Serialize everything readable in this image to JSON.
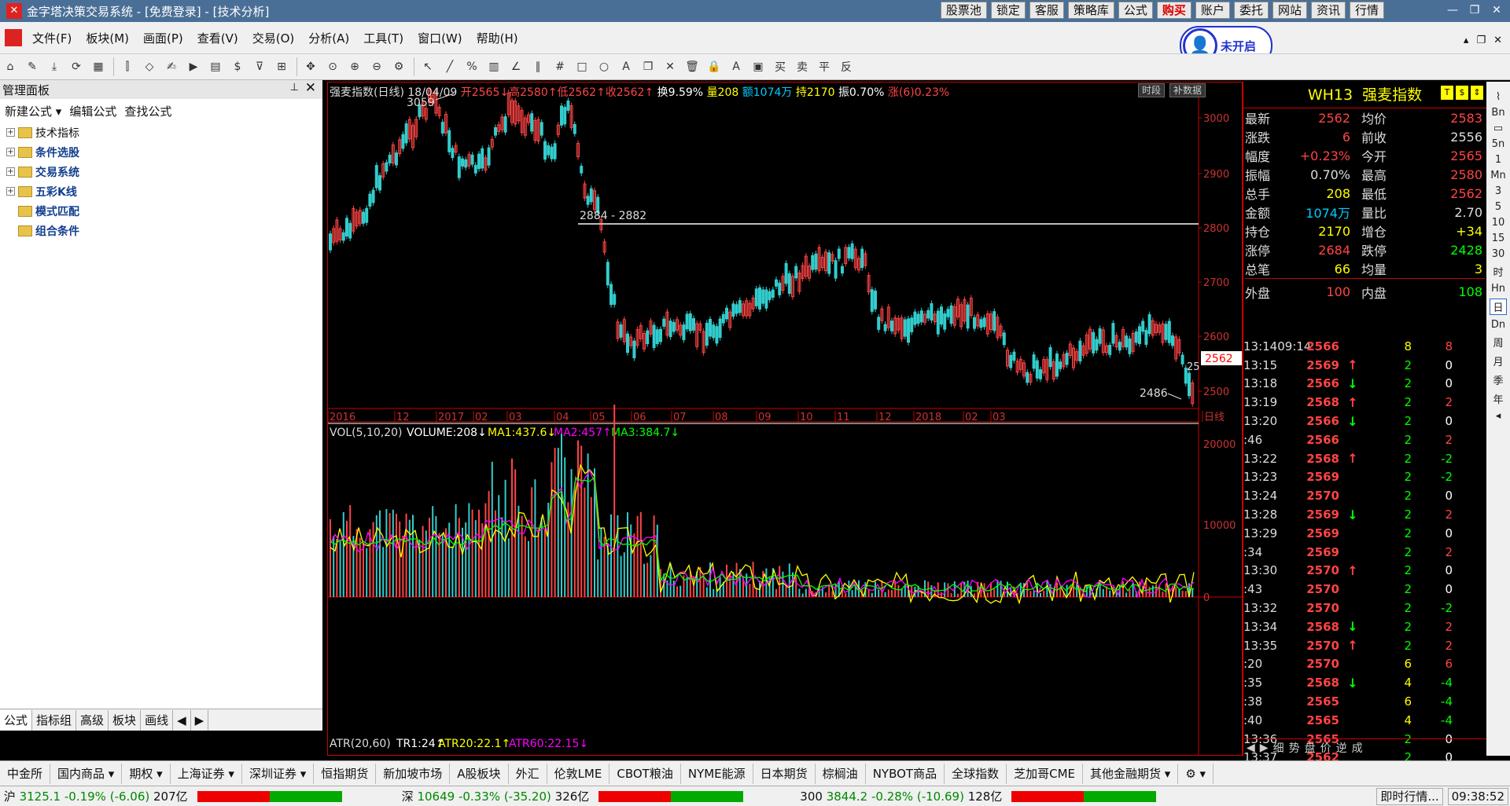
{
  "window": {
    "title": "金字塔决策交易系统 - [免费登录] - [技术分析]",
    "logo_glyph": "✕"
  },
  "top_buttons": [
    "股票池",
    "锁定",
    "客服",
    "策略库",
    "公式",
    "购买",
    "账户",
    "委托",
    "网站",
    "资讯",
    "行情"
  ],
  "window_controls": {
    "minimize": "—",
    "restore": "❐",
    "close": "✕"
  },
  "menu": [
    "文件(F)",
    "板块(M)",
    "画面(P)",
    "查看(V)",
    "交易(O)",
    "分析(A)",
    "工具(T)",
    "窗口(W)",
    "帮助(H)"
  ],
  "login_badge": {
    "icon": "person-icon",
    "text": "未开启"
  },
  "mdi_controls": [
    "▴",
    "❐",
    "✕"
  ],
  "toolbar_icons": [
    "home-icon",
    "pencil-icon",
    "download-icon",
    "refresh-icon",
    "grid-icon",
    "candles-icon",
    "diamond-icon",
    "edit-icon",
    "play-icon",
    "doc-icon",
    "dollar-icon",
    "filter-icon",
    "chart-icon",
    "move-icon",
    "zoom-reset-icon",
    "zoom-in-icon",
    "zoom-out-icon",
    "settings-icon",
    "cursor-icon",
    "line-icon",
    "percent-icon",
    "ruler-icon",
    "angle-icon",
    "parallel-icon",
    "hash-icon",
    "rect-icon",
    "circle-icon",
    "text-icon",
    "copy-icon",
    "delete-icon",
    "trash-icon",
    "lock-icon",
    "color-icon",
    "save-icon",
    "buy-icon",
    "sell-icon",
    "flat-icon",
    "reverse-icon"
  ],
  "toolbar_glyphs": [
    "⌂",
    "✎",
    "⤓",
    "⟳",
    "▦",
    "⫿",
    "◇",
    "✍",
    "▶",
    "▤",
    "$",
    "⊽",
    "⊞",
    "✥",
    "⊙",
    "⊕",
    "⊖",
    "⚙",
    "↖",
    "╱",
    "%",
    "▥",
    "∠",
    "∥",
    "#",
    "□",
    "○",
    "A",
    "❐",
    "✕",
    "🗑",
    "🔒",
    "A",
    "▣",
    "买",
    "卖",
    "平",
    "反"
  ],
  "left_panel": {
    "title": "管理面板",
    "pin": "⊥",
    "close": "✕",
    "links": [
      "新建公式 ▾",
      "编辑公式",
      "查找公式"
    ],
    "tree": [
      "技术指标",
      "条件选股",
      "交易系统",
      "五彩K线",
      "模式匹配",
      "组合条件"
    ],
    "tabs": [
      "公式",
      "指标组",
      "高级",
      "板块",
      "画线",
      "◀",
      "▶"
    ]
  },
  "chart_header": {
    "name": "强麦指数(日线)",
    "date": "18/04/09",
    "open": "开2565↓",
    "high": "高2580↑",
    "low": "低2562↑",
    "close": "收2562↑",
    "turnover": "换9.59%",
    "volume": "量208",
    "amount": "额1074万",
    "oi": "持2170",
    "amplitude": "振0.70%",
    "change": "涨(6)0.23%"
  },
  "chart_buttons": [
    "时段",
    "补数据"
  ],
  "price_axis": [
    "3000",
    "2900",
    "2800",
    "2700",
    "2600",
    "2500"
  ],
  "time_axis": [
    "2016",
    "12",
    "2017",
    "02",
    "03",
    "04",
    "05",
    "06",
    "07",
    "08",
    "09",
    "10",
    "11",
    "12",
    "2018",
    "02",
    "03",
    "日线"
  ],
  "annotations": {
    "high": "3059",
    "low": "2486",
    "range_label": "2884 - 2882",
    "last_price": "2562",
    "last_tag": "25"
  },
  "vol_header": {
    "name": "VOL(5,10,20)",
    "vol": "VOLUME:208↓",
    "ma1": "MA1:437.6↓",
    "ma2": "MA2:457↑",
    "ma3": "MA3:384.7↓"
  },
  "vol_axis": [
    "20000",
    "10000",
    "0"
  ],
  "atr_header": {
    "name": "ATR(20,60)",
    "tr1": "TR1:24↑",
    "atr20": "ATR20:22.1↑",
    "atr60": "ATR60:22.15↓"
  },
  "quote": {
    "code": "WH13",
    "name": "强麦指数",
    "icons": [
      "T",
      "$",
      "⇕"
    ],
    "rows": [
      {
        "l1": "最新",
        "v1": "2562",
        "c1": "#f44",
        "l2": "均价",
        "v2": "2583",
        "c2": "#f44"
      },
      {
        "l1": "涨跌",
        "v1": "6",
        "c1": "#f44",
        "l2": "前收",
        "v2": "2556",
        "c2": "#ddd"
      },
      {
        "l1": "幅度",
        "v1": "+0.23%",
        "c1": "#f44",
        "l2": "今开",
        "v2": "2565",
        "c2": "#f44"
      },
      {
        "l1": "振幅",
        "v1": "0.70%",
        "c1": "#ddd",
        "l2": "最高",
        "v2": "2580",
        "c2": "#f44"
      },
      {
        "l1": "总手",
        "v1": "208",
        "c1": "#ff0",
        "l2": "最低",
        "v2": "2562",
        "c2": "#f44"
      },
      {
        "l1": "金额",
        "v1": "1074万",
        "c1": "#0cf",
        "l2": "量比",
        "v2": "2.70",
        "c2": "#ddd"
      },
      {
        "l1": "持仓",
        "v1": "2170",
        "c1": "#ff0",
        "l2": "增仓",
        "v2": "+34",
        "c2": "#ff0"
      },
      {
        "l1": "涨停",
        "v1": "2684",
        "c1": "#f44",
        "l2": "跌停",
        "v2": "2428",
        "c2": "#0f0"
      },
      {
        "l1": "总笔",
        "v1": "66",
        "c1": "#ff0",
        "l2": "均量",
        "v2": "3",
        "c2": "#ff0"
      }
    ],
    "outer": {
      "l1": "外盘",
      "v1": "100",
      "l2": "内盘",
      "v2": "108"
    },
    "ticks": [
      {
        "t": "13:14",
        "t2": "09:14",
        "p": "2566",
        "a": "",
        "v": "8",
        "c": "8"
      },
      {
        "t": "13:15",
        "t2": "",
        "p": "2569",
        "a": "↑",
        "v": "2",
        "c": "0"
      },
      {
        "t": "13:18",
        "t2": "",
        "p": "2566",
        "a": "↓",
        "v": "2",
        "c": "0"
      },
      {
        "t": "13:19",
        "t2": "",
        "p": "2568",
        "a": "↑",
        "v": "2",
        "c": "2"
      },
      {
        "t": "13:20",
        "t2": "",
        "p": "2566",
        "a": "↓",
        "v": "2",
        "c": "0"
      },
      {
        "t": ":46",
        "t2": "",
        "p": "2566",
        "a": "",
        "v": "2",
        "c": "2"
      },
      {
        "t": "13:22",
        "t2": "",
        "p": "2568",
        "a": "↑",
        "v": "2",
        "c": "-2"
      },
      {
        "t": "13:23",
        "t2": "",
        "p": "2569",
        "a": "",
        "v": "2",
        "c": "-2"
      },
      {
        "t": "13:24",
        "t2": "",
        "p": "2570",
        "a": "",
        "v": "2",
        "c": "0"
      },
      {
        "t": "13:28",
        "t2": "",
        "p": "2569",
        "a": "↓",
        "v": "2",
        "c": "2"
      },
      {
        "t": "13:29",
        "t2": "",
        "p": "2569",
        "a": "",
        "v": "2",
        "c": "0"
      },
      {
        "t": ":34",
        "t2": "",
        "p": "2569",
        "a": "",
        "v": "2",
        "c": "2"
      },
      {
        "t": "13:30",
        "t2": "",
        "p": "2570",
        "a": "↑",
        "v": "2",
        "c": "0"
      },
      {
        "t": ":43",
        "t2": "",
        "p": "2570",
        "a": "",
        "v": "2",
        "c": "0"
      },
      {
        "t": "13:32",
        "t2": "",
        "p": "2570",
        "a": "",
        "v": "2",
        "c": "-2"
      },
      {
        "t": "13:34",
        "t2": "",
        "p": "2568",
        "a": "↓",
        "v": "2",
        "c": "2"
      },
      {
        "t": "13:35",
        "t2": "",
        "p": "2570",
        "a": "↑",
        "v": "2",
        "c": "2"
      },
      {
        "t": ":20",
        "t2": "",
        "p": "2570",
        "a": "",
        "v": "6",
        "c": "6"
      },
      {
        "t": ":35",
        "t2": "",
        "p": "2568",
        "a": "↓",
        "v": "4",
        "c": "-4"
      },
      {
        "t": ":38",
        "t2": "",
        "p": "2565",
        "a": "",
        "v": "6",
        "c": "-4"
      },
      {
        "t": ":40",
        "t2": "",
        "p": "2565",
        "a": "",
        "v": "4",
        "c": "-4"
      },
      {
        "t": "13:36",
        "t2": "",
        "p": "2565",
        "a": "",
        "v": "2",
        "c": "0"
      },
      {
        "t": "13:37",
        "t2": "",
        "p": "2562",
        "a": "",
        "v": "2",
        "c": "0"
      }
    ],
    "tabs": [
      "◀",
      "▶",
      "细",
      "势",
      "盘",
      "价",
      "逆",
      "成"
    ]
  },
  "right_strip": [
    "⌇",
    "Bn",
    "▭",
    "5n",
    "1",
    "Mn",
    "3",
    "5",
    "10",
    "15",
    "30",
    "时",
    "Hn",
    "日",
    "Dn",
    "周",
    "月",
    "季",
    "年",
    "◂"
  ],
  "bottom_tabs": [
    "中金所",
    "国内商品 ▾",
    "期权 ▾",
    "上海证券 ▾",
    "深圳证券 ▾",
    "恒指期货",
    "新加坡市场",
    "A股板块",
    "外汇",
    "伦敦LME",
    "CBOT粮油",
    "NYME能源",
    "日本期货",
    "棕榈油",
    "NYBOT商品",
    "全球指数",
    "芝加哥CME",
    "其他金融期货 ▾",
    "⚙ ▾"
  ],
  "status": {
    "sh": {
      "label": "沪",
      "value": "3125.1",
      "chg": "-0.19%",
      "diff": "(-6.06)",
      "amt": "207亿"
    },
    "sz": {
      "label": "深",
      "value": "10649",
      "chg": "-0.33%",
      "diff": "(-35.20)",
      "amt": "326亿"
    },
    "hs300": {
      "label": "300",
      "value": "3844.2",
      "chg": "-0.28%",
      "diff": "(-10.69)",
      "amt": "128亿"
    },
    "realtime": "即时行情...",
    "time": "09:38:52"
  },
  "colors": {
    "up": "#f44",
    "down": "#0f0",
    "bg": "#000",
    "frame": "#c00"
  }
}
